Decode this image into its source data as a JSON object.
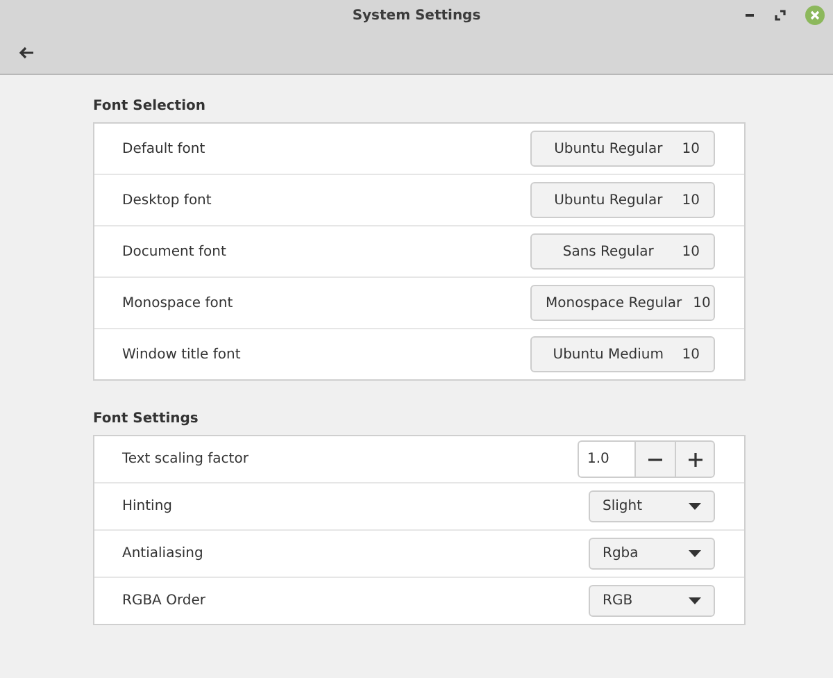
{
  "window": {
    "title": "System Settings"
  },
  "sections": [
    {
      "title": "Font Selection",
      "rows": [
        {
          "kind": "font",
          "label": "Default font",
          "value": "Ubuntu Regular",
          "size": "10"
        },
        {
          "kind": "font",
          "label": "Desktop font",
          "value": "Ubuntu Regular",
          "size": "10"
        },
        {
          "kind": "font",
          "label": "Document font",
          "value": "Sans Regular",
          "size": "10"
        },
        {
          "kind": "font",
          "label": "Monospace font",
          "value": "Monospace Regular",
          "size": "10"
        },
        {
          "kind": "font",
          "label": "Window title font",
          "value": "Ubuntu Medium",
          "size": "10"
        }
      ]
    },
    {
      "title": "Font Settings",
      "rows": [
        {
          "kind": "spin",
          "label": "Text scaling factor",
          "value": "1.0"
        },
        {
          "kind": "combo",
          "label": "Hinting",
          "value": "Slight"
        },
        {
          "kind": "combo",
          "label": "Antialiasing",
          "value": "Rgba"
        },
        {
          "kind": "combo",
          "label": "RGBA Order",
          "value": "RGB"
        }
      ]
    }
  ]
}
